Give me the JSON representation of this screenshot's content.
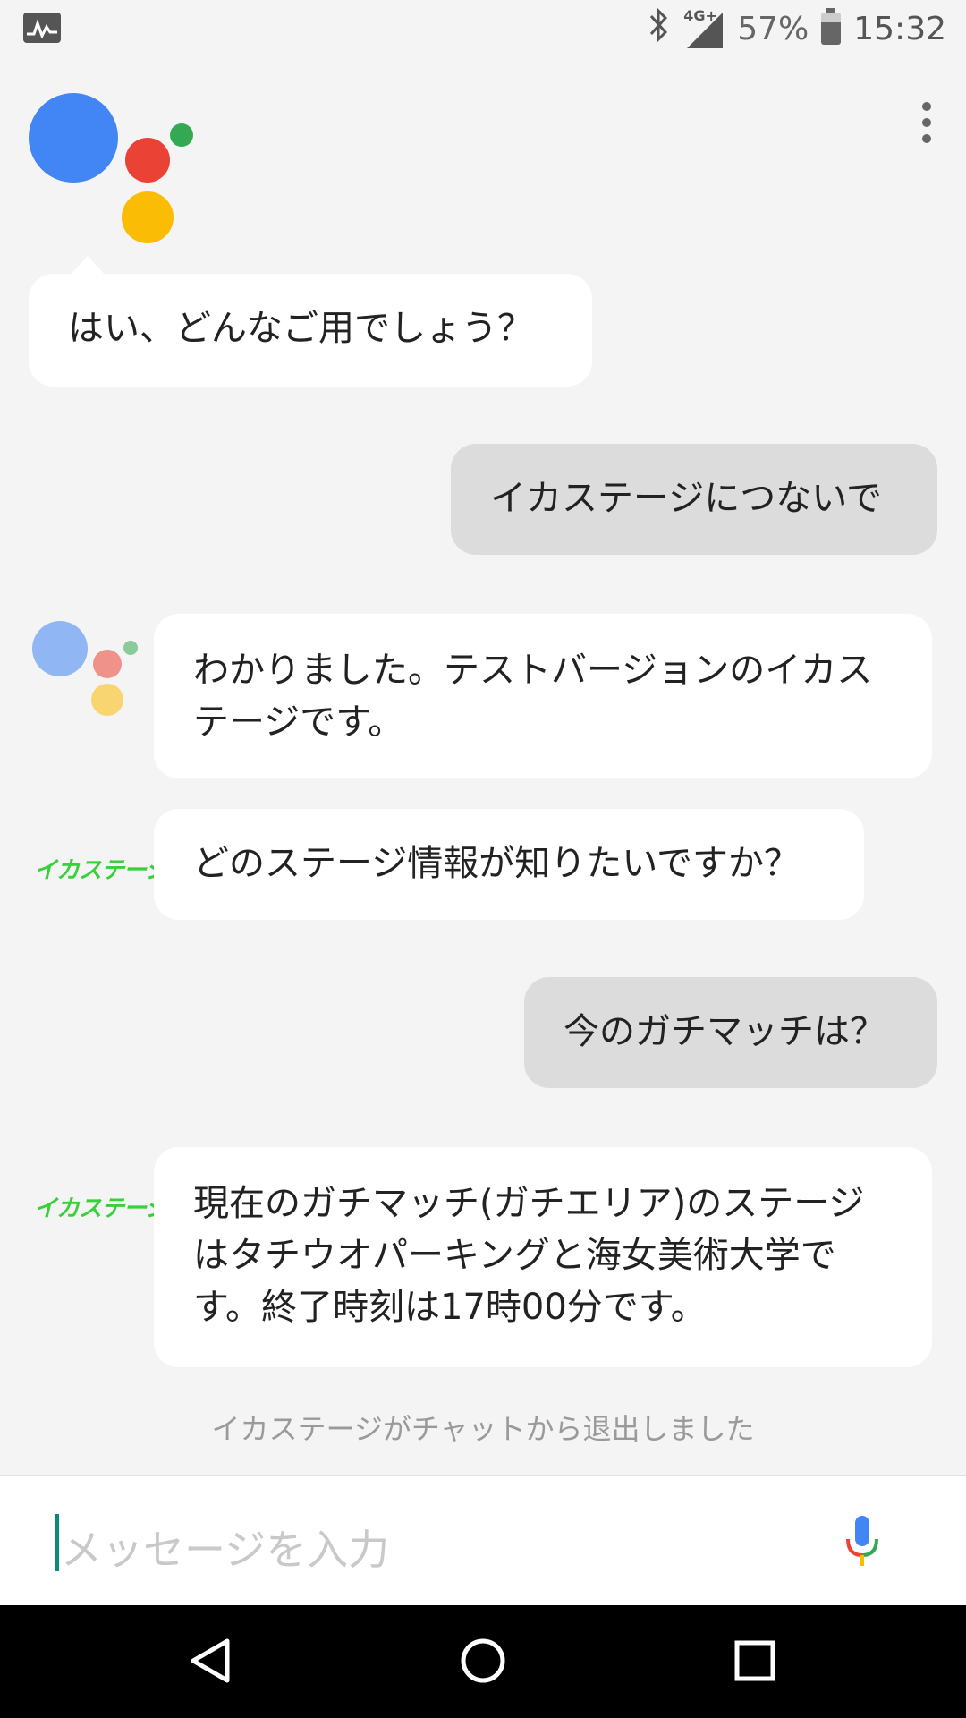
{
  "status_bar": {
    "signal_label": "4G+",
    "battery_percent": "57%",
    "time": "15:32",
    "icons": [
      "activity-icon",
      "bluetooth-icon",
      "signal-icon",
      "battery-icon"
    ]
  },
  "assistant": {
    "logo_colors": [
      "#4285F4",
      "#EA4335",
      "#FBBC05",
      "#34A853"
    ]
  },
  "conversation": [
    {
      "from": "assistant",
      "text": "はい、どんなご用でしょう？"
    },
    {
      "from": "user",
      "text": "イカステージにつないで"
    },
    {
      "from": "assistant",
      "text": "わかりました。テストバージョンのイカステージです。"
    },
    {
      "from": "app",
      "app_name": "イカステージ",
      "text": "どのステージ情報が知りたいですか？"
    },
    {
      "from": "user",
      "text": "今のガチマッチは？"
    },
    {
      "from": "app",
      "app_name": "イカステージ",
      "text": "現在のガチマッチ(ガチエリア)のステージはタチウオパーキングと海女美術大学です。終了時刻は17時00分です。"
    }
  ],
  "system_note": "イカステージがチャットから退出しました",
  "input": {
    "placeholder": "メッセージを入力",
    "mic_icon": "mic-icon"
  },
  "navigation": {
    "back": "back-icon",
    "home": "home-icon",
    "recents": "recents-icon"
  }
}
